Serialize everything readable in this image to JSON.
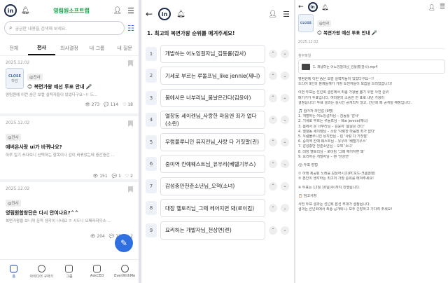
{
  "p1": {
    "brand": "영림원소프트랩",
    "search_placeholder": "궁금한 내용을 검색해 보세요.",
    "tabs": [
      "전체",
      "전사",
      "의사결정",
      "내 그룹",
      "내 질문"
    ],
    "posts": [
      {
        "date": "2025.12.02",
        "chip": "@전사",
        "title": "😊 복면가왕 예선 투표 안내 🎤",
        "body": "영림원에 이런 숨은 보컬 실력자들이 있었다구요~!! 드...",
        "views": "273",
        "comments": "114",
        "likes": "18",
        "thumb_top": "CLOSE",
        "thumb_bottom": "마감"
      },
      {
        "date": "2025.12.02",
        "chip": "@전사",
        "title": "에버온사랑 ui가 바뀌나요?",
        "body": "하루 일기 쓰다보니 선택하는 항목이나 갑이 바뀌었는데 중간중간 ...",
        "views": "151",
        "comments": "1",
        "likes": "2"
      },
      {
        "date": "2025.12.02",
        "chip": "@전사",
        "title": "영림원합창단은 다시 안여나요?^^",
        "body": "복면가왕을 보니까 문득 생각이 나네요 ㅎ 시드니 오페라하우스 ...",
        "views": "204",
        "comments": "11",
        "likes": "2"
      }
    ],
    "nav": [
      "홈",
      "아이디어 구하기",
      "그룹",
      "AskCEO",
      "EverWithMe"
    ]
  },
  "p2": {
    "question": "1. 최고의 복면가왕 순위를 매겨주세요!",
    "options": [
      "개발하는 어노잉걸자님_김동률(감사)",
      "기세로 부르는 루돌프님_like jennie(제니)",
      "봄에서온 너부리님_봄날은간다(김윤아)",
      "열창동 세이렌님_사랑한 마음엔 죄가 없다(소란)",
      "우럼불루니인 뮤지컨님_사랑 다 거짓말(린)",
      "중미역 칸예웨스트님_유우리(베텔기우스)",
      "감성충만천춘소년님_오혁(소녀)",
      "대장 헬토리님_그때 헤어지면 돼(로이킴)",
      "요리하는 개발자님_천상연(렌)"
    ]
  },
  "p3": {
    "chip": "@전사",
    "title": "😊 복면가왕 예선 투표 안내 🎤",
    "thumb": "CLOSE",
    "date": "2025.12.02",
    "attach_label": "첨부파일",
    "file_name": "1. 재생하는 어노잉걸자님_김동률(감사).mp4",
    "lines": [
      "영림원에 이런 숨은 보컬 실력자들이 있었다구요~!!",
      "드디어 9인의 참체들께가 가창 도전자들이 모습을 드러냈습니다!",
      "",
      "이번 투표는 선넌회 결선에서 최종 가왕을 뽑기 위한 사전 순위",
      "매기기가 투표입니다. 여러분의 소중한 한 표로 내년 가왕이",
      "결정됩니다! 투표 결과는 실시간 공개되지 않고, 선넌회 때 공개될 예정입니다.",
      "",
      "🎵 참가자 라인업 (9명)",
      "1. 개발하는 어노잉걸자님 – 김동률 '감사'",
      "2. 기세로 부르는 루돌프님 – like jennie(제니)",
      "3. 봄에서 온 너부리님 – 김윤아 '봄날은 간다'",
      "4. 열창동 세이렌님 – 소란 '사랑한 마음엔 죄가 없다'",
      "5. 우럼불루니인 뮤지컨님 – 린 '사랑 다 거짓말'",
      "6. 중미역 칸예 웨스트님 – 유우리 '베텔기우스'",
      "7. 감성충만 천춘소년님 – 오혁 '소녀'",
      "8. 대장 헬토리님 – 로이킴 '그때 헤어지면 돼'",
      "9. 요리하는 개발자님 – 렌 '천상연'",
      "",
      "🗳 투표 방법",
      "",
      "① 아래 제공된 노래를 감상하시고(PC모드-크롬권장)",
      "② 본인이 생각하는 최고의 가창 순위를 매겨주세요!",
      "",
      "※ 투표는 12월 10일(수)까지 진행됩니다.",
      "",
      "📋 참고사항",
      "",
      "사전 투표 결과는 선넌회 본선 무대가 결정됩니다.",
      "결과는 선넌회에서 최종 공개되니, 모두 긴장하고 기다려 주세요!"
    ]
  },
  "colors": {
    "brand_green": "#1aa34a",
    "accent_blue": "#2f6fe0",
    "navy": "#1b2a4a"
  }
}
